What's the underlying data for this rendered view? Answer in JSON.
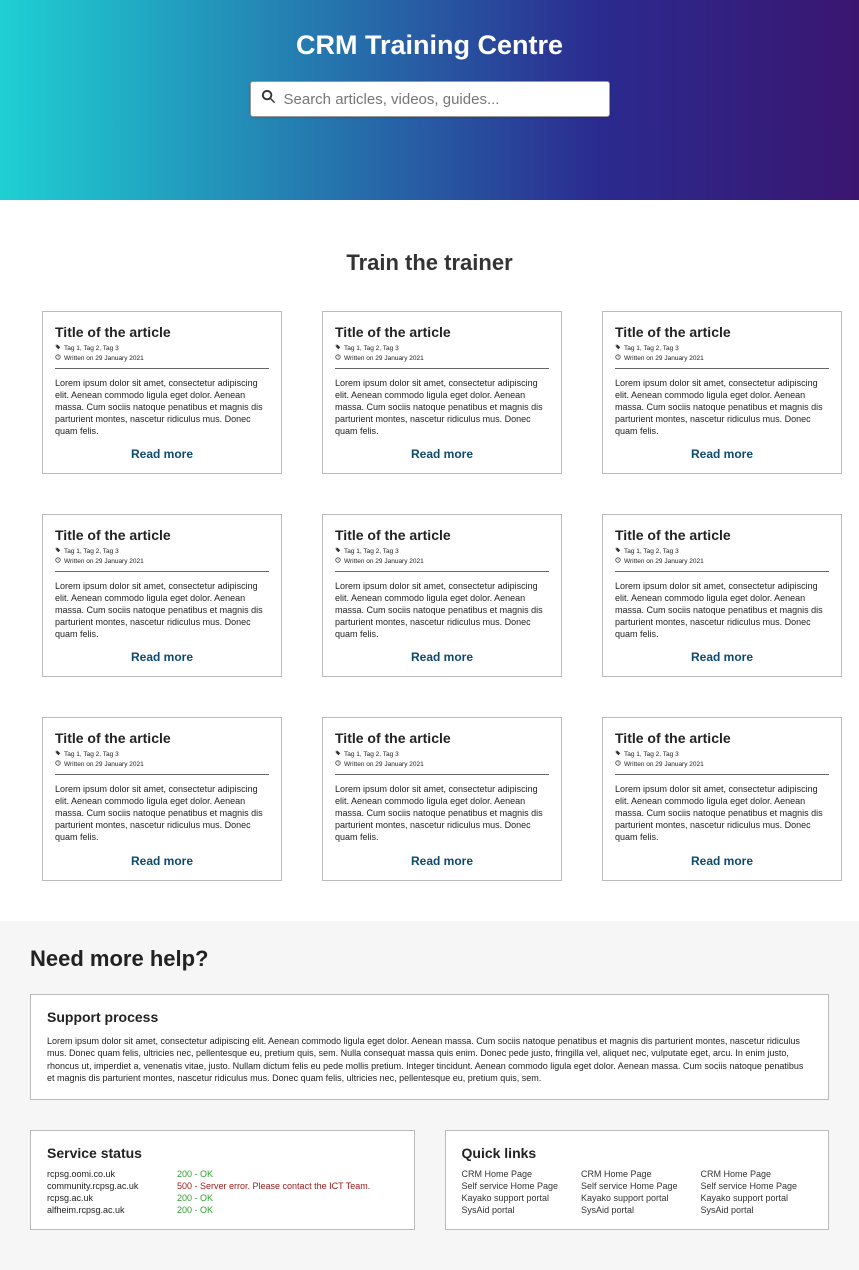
{
  "hero": {
    "title": "CRM Training Centre",
    "search_placeholder": "Search articles, videos, guides..."
  },
  "section_title": "Train the trainer",
  "card": {
    "title": "Title of the article",
    "tags": "Tag 1, Tag 2, Tag 3",
    "date": "Written on 29 January 2021",
    "excerpt": "Lorem ipsum dolor sit amet, consectetur adipiscing elit. Aenean commodo ligula eget dolor. Aenean massa. Cum sociis natoque penatibus et magnis dis parturient montes, nascetur ridiculus mus. Donec quam felis.",
    "readmore": "Read more"
  },
  "help": {
    "title": "Need more help?",
    "support_heading": "Support process",
    "support_text": "Lorem ipsum dolor sit amet, consectetur adipiscing elit. Aenean commodo ligula eget dolor. Aenean massa. Cum sociis natoque penatibus et magnis dis parturient montes, nascetur ridiculus mus. Donec quam felis, ultricies nec, pellentesque eu, pretium quis, sem. Nulla consequat massa quis enim. Donec pede justo, fringilla vel, aliquet nec, vulputate eget, arcu. In enim justo, rhoncus ut, imperdiet a, venenatis vitae, justo. Nullam dictum felis eu pede mollis pretium. Integer tincidunt. Aenean commodo ligula eget dolor. Aenean massa. Cum sociis natoque penatibus et magnis dis parturient montes, nascetur ridiculus mus. Donec quam felis, ultricies nec, pellentesque eu, pretium quis, sem."
  },
  "status": {
    "heading": "Service status",
    "items": [
      {
        "host": "rcpsg.oomi.co.uk",
        "code": "200 - OK",
        "ok": true
      },
      {
        "host": "community.rcpsg.ac.uk",
        "code": "500 - Server error. Please contact the ICT Team.",
        "ok": false
      },
      {
        "host": "rcpsg.ac.uk",
        "code": "200 - OK",
        "ok": true
      },
      {
        "host": "alfheim.rcpsg.ac.uk",
        "code": "200 - OK",
        "ok": true
      }
    ]
  },
  "quicklinks": {
    "heading": "Quick links",
    "cols": [
      [
        "CRM Home Page",
        "Self service Home Page",
        "Kayako support portal",
        "SysAid portal"
      ],
      [
        "CRM Home Page",
        "Self service Home Page",
        "Kayako support portal",
        "SysAid portal"
      ],
      [
        "CRM Home Page",
        "Self service Home Page",
        "Kayako support portal",
        "SysAid portal"
      ]
    ]
  }
}
